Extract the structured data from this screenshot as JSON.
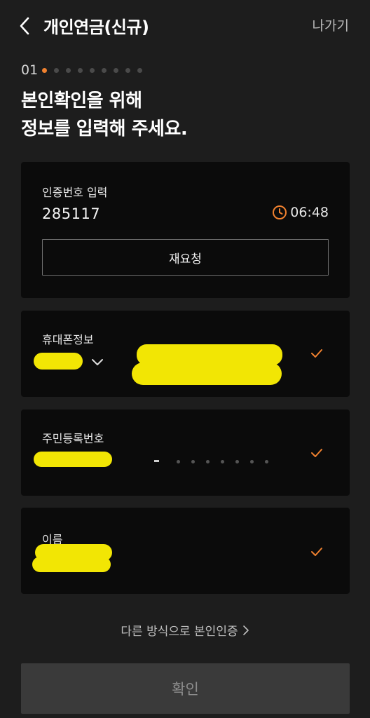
{
  "header": {
    "title": "개인연금(신규)",
    "exit_label": "나가기",
    "back_icon": "chevron-left-icon"
  },
  "progress": {
    "step_label": "01",
    "current_step": 1,
    "total_steps": 9,
    "active_color": "#f0812f"
  },
  "headline": "본인확인을 위해\n정보를 입력해 주세요.",
  "verification": {
    "label": "인증번호 입력",
    "code": "285117",
    "timer": "06:48",
    "timer_icon": "clock-icon",
    "resend_label": "재요청"
  },
  "phone": {
    "label": "휴대폰정보",
    "carrier_icon": "chevron-down-icon",
    "status_icon": "check-icon"
  },
  "rrn": {
    "label": "주민등록번호",
    "status_icon": "check-icon"
  },
  "name": {
    "label": "이름",
    "status_icon": "check-icon"
  },
  "alt_auth_label": "다른 방식으로 본인인증",
  "confirm_label": "확인",
  "colors": {
    "background": "#1d1d1d",
    "card": "#0b0b0b",
    "accent": "#f0812f",
    "redaction": "#f2e604"
  }
}
